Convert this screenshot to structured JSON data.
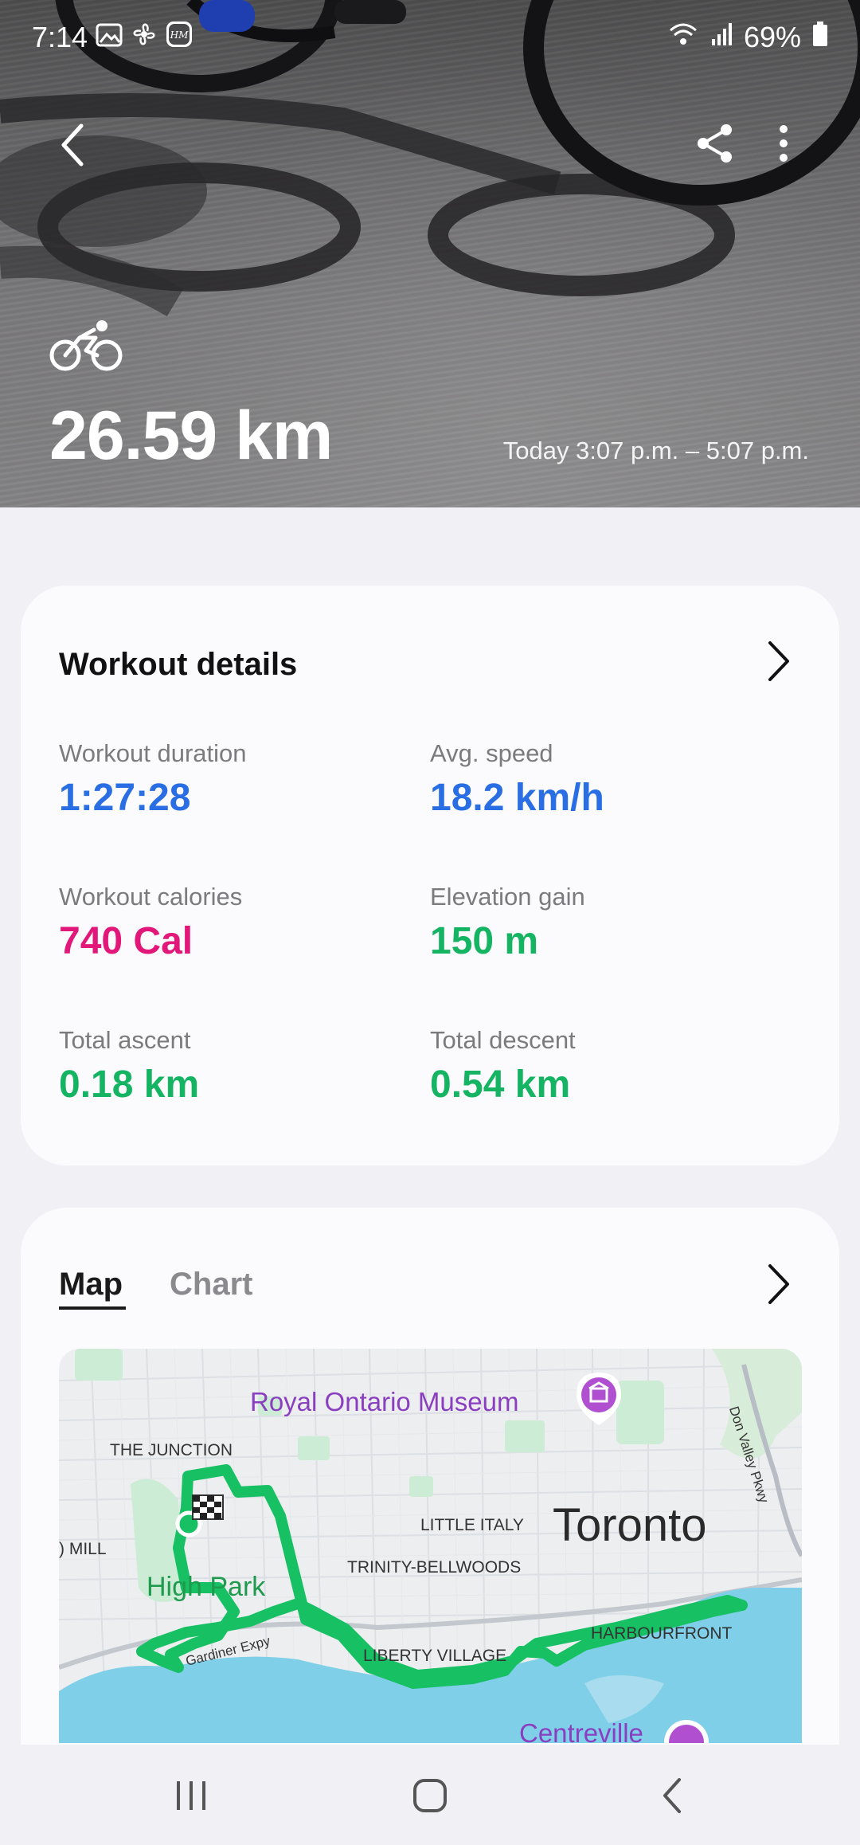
{
  "status_bar": {
    "time": "7:14",
    "battery": "69%"
  },
  "hero": {
    "activity_icon": "cycling-icon",
    "distance": "26.59 km",
    "time_range": "Today 3:07 p.m. – 5:07 p.m."
  },
  "workout_details": {
    "title": "Workout details",
    "metrics": [
      {
        "label": "Workout duration",
        "value": "1:27:28",
        "color": "#2a6ee3"
      },
      {
        "label": "Avg. speed",
        "value": "18.2 km/h",
        "color": "#2a6ee3"
      },
      {
        "label": "Workout calories",
        "value": "740 Cal",
        "color": "#e2177a"
      },
      {
        "label": "Elevation gain",
        "value": "150 m",
        "color": "#15b462"
      },
      {
        "label": "Total ascent",
        "value": "0.18 km",
        "color": "#15b462"
      },
      {
        "label": "Total descent",
        "value": "0.54 km",
        "color": "#15b462"
      }
    ]
  },
  "map_section": {
    "tabs": [
      {
        "label": "Map",
        "selected": true
      },
      {
        "label": "Chart",
        "selected": false
      }
    ],
    "labels": {
      "museum": "Royal Ontario Museum",
      "junction": "THE JUNCTION",
      "mill": ") MILL",
      "high_park": "High Park",
      "little_italy": "LITTLE ITALY",
      "toronto": "Toronto",
      "trinity": "TRINITY-BELLWOODS",
      "gardiner": "Gardiner Expy",
      "liberty": "LIBERTY VILLAGE",
      "harbourfront": "HARBOURFRONT",
      "centreville": "Centreville",
      "don_valley": "Don Valley Pkwy"
    },
    "route_color": "#16c063"
  },
  "nav_bar": {
    "buttons": [
      "recent-apps",
      "home",
      "back"
    ]
  }
}
